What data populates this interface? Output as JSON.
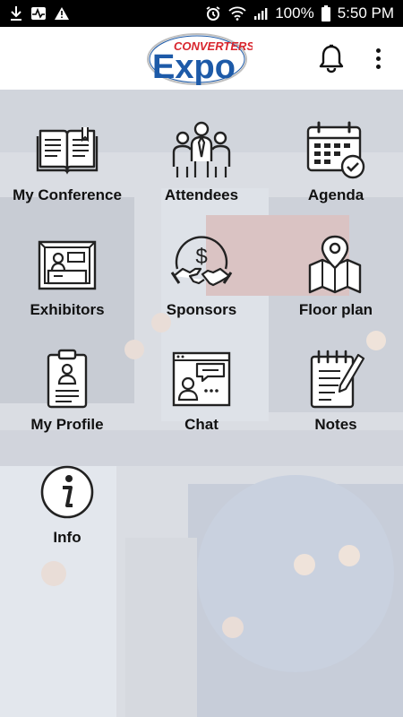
{
  "status_bar": {
    "battery_percent": "100%",
    "time": "5:50 PM",
    "left_icons": [
      "download-icon",
      "pulse-icon",
      "warning-icon"
    ],
    "right_icons": [
      "alarm-icon",
      "wifi-icon",
      "signal-icon",
      "battery-icon"
    ]
  },
  "header": {
    "logo_top": "CONVERTERS",
    "logo_main": "Expo",
    "colors": {
      "logo_red": "#d8262e",
      "logo_blue": "#1d5aa8"
    }
  },
  "menu": [
    {
      "label": "My Conference",
      "icon": "book-icon"
    },
    {
      "label": "Attendees",
      "icon": "people-icon"
    },
    {
      "label": "Agenda",
      "icon": "calendar-icon"
    },
    {
      "label": "Exhibitors",
      "icon": "booth-icon"
    },
    {
      "label": "Sponsors",
      "icon": "handshake-dollar-icon"
    },
    {
      "label": "Floor plan",
      "icon": "map-pin-icon"
    },
    {
      "label": "My Profile",
      "icon": "badge-clipboard-icon"
    },
    {
      "label": "Chat",
      "icon": "chat-icon"
    },
    {
      "label": "Notes",
      "icon": "notepad-icon"
    },
    {
      "label": "Info",
      "icon": "info-icon"
    }
  ]
}
